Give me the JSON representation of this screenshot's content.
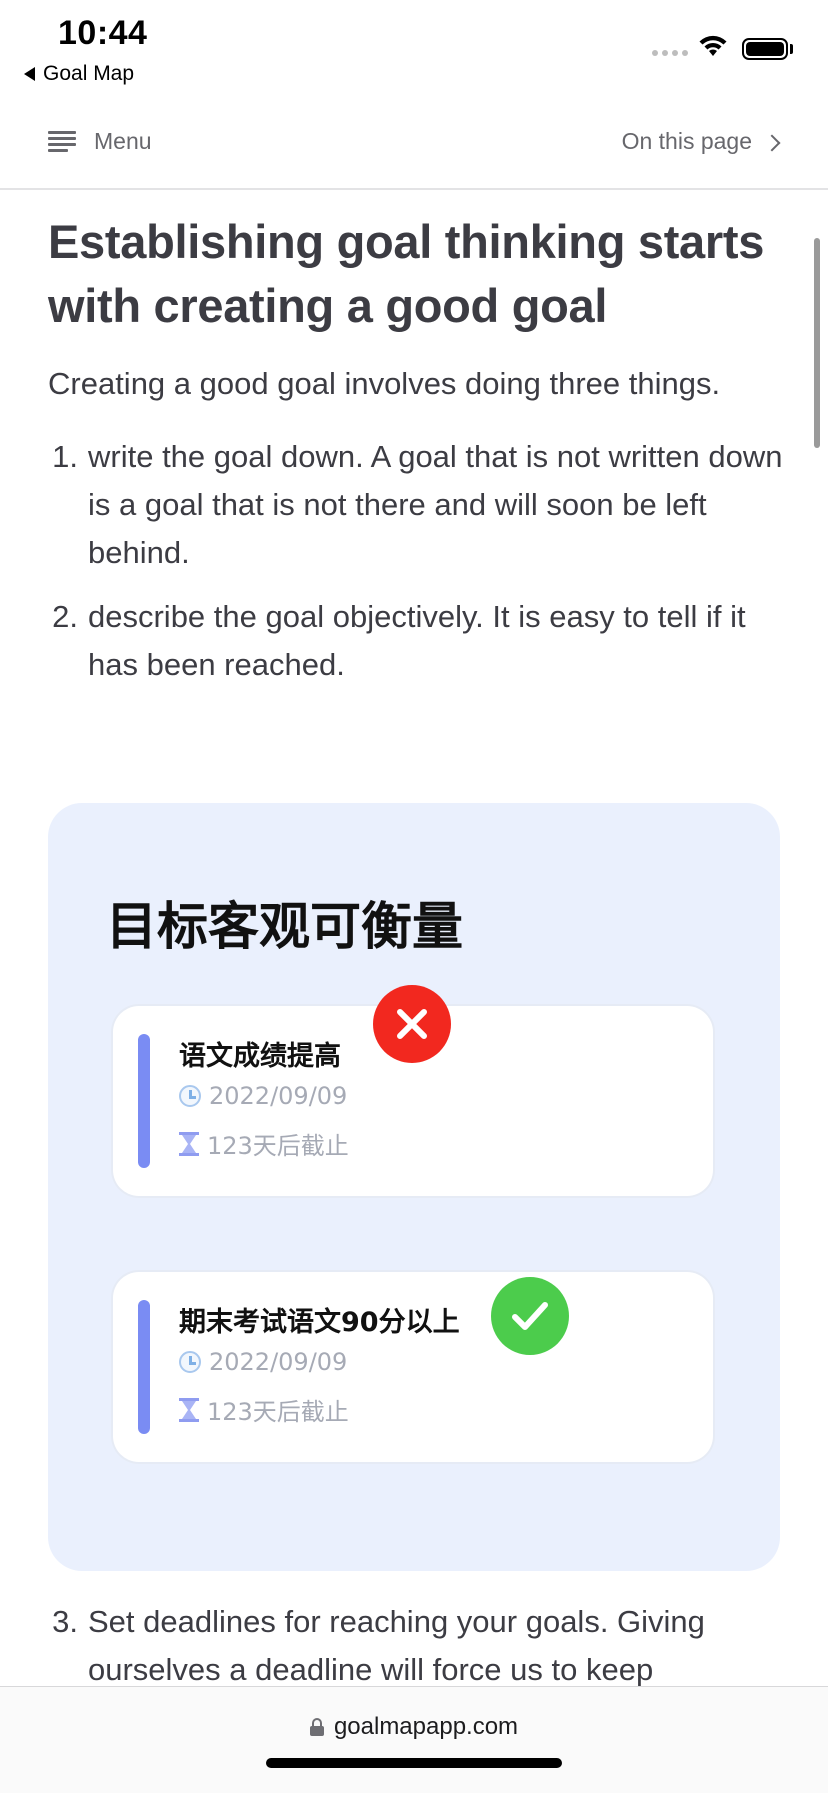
{
  "status_bar": {
    "time": "10:44",
    "back_app": "Goal Map"
  },
  "nav": {
    "menu_label": "Menu",
    "on_this_page_label": "On this page"
  },
  "article": {
    "title": "Establishing goal thinking starts with creating a good goal",
    "lead": "Creating a good goal involves doing three things.",
    "steps": [
      {
        "num": "1.",
        "text": "write the goal down. A goal that is not written down is a goal that is not there and will soon be left behind."
      },
      {
        "num": "2.",
        "text": "describe the goal objectively. It is easy to tell if it has been reached."
      },
      {
        "num": "3.",
        "text": "Set deadlines for reaching your goals. Giving ourselves a deadline will force us to keep"
      }
    ]
  },
  "illustration": {
    "title": "目标客观可衡量",
    "cards": [
      {
        "name": "语文成绩提高",
        "date": "2022/09/09",
        "deadline": "123天后截止",
        "mark": "cross",
        "mark_color": "#f2281f"
      },
      {
        "name": "期末考试语文90分以上",
        "date": "2022/09/09",
        "deadline": "123天后截止",
        "mark": "check",
        "mark_color": "#4ccc4c"
      }
    ]
  },
  "address_bar": {
    "url": "goalmapapp.com"
  }
}
